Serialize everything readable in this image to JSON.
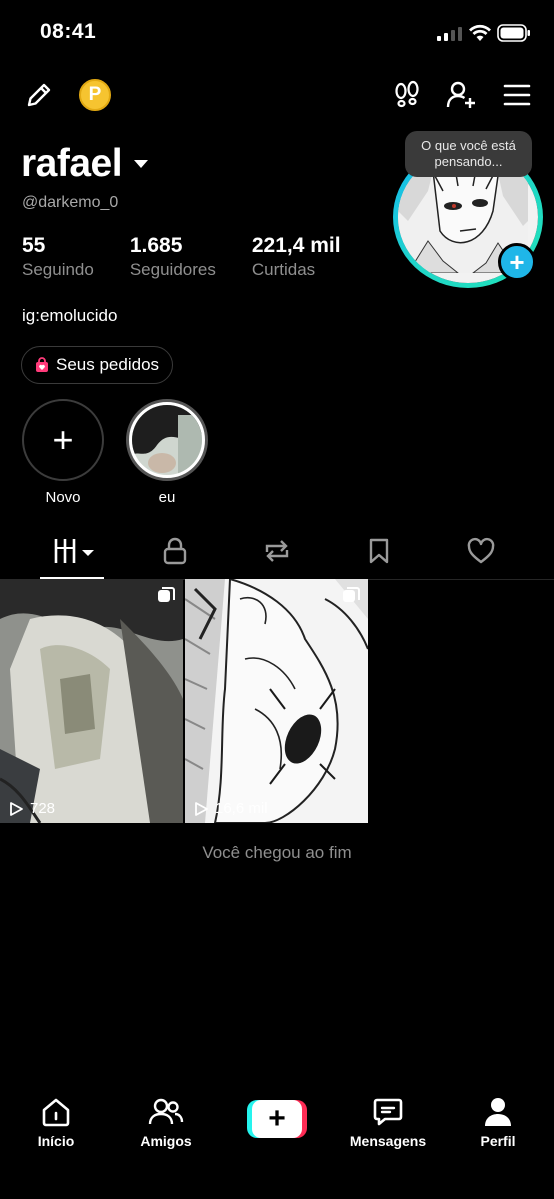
{
  "status": {
    "time": "08:41"
  },
  "header": {
    "coin_letter": "P"
  },
  "profile": {
    "username": "rafael",
    "handle": "@darkemo_0",
    "stats": [
      {
        "value": "55",
        "label": "Seguindo"
      },
      {
        "value": "1.685",
        "label": "Seguidores"
      },
      {
        "value": "221,4 mil",
        "label": "Curtidas"
      }
    ],
    "bio": "ig:emolucido",
    "orders_label": "Seus pedidos",
    "bubble_text": "O que você está pensando..."
  },
  "highlights": [
    {
      "label": "Novo"
    },
    {
      "label": "eu"
    }
  ],
  "posts": [
    {
      "views": "728"
    },
    {
      "views": "16,6 mil"
    }
  ],
  "end_text": "Você chegou ao fim",
  "nav": [
    {
      "label": "Início",
      "icon": "home-icon"
    },
    {
      "label": "Amigos",
      "icon": "friends-icon"
    },
    {
      "label": "",
      "icon": "create-icon"
    },
    {
      "label": "Mensagens",
      "icon": "messages-icon"
    },
    {
      "label": "Perfil",
      "icon": "profile-icon"
    }
  ],
  "colors": {
    "accent": "#1fb6e8",
    "tiktok_cyan": "#25f4ee",
    "tiktok_red": "#fe2c55",
    "coin": "#f6c430"
  }
}
